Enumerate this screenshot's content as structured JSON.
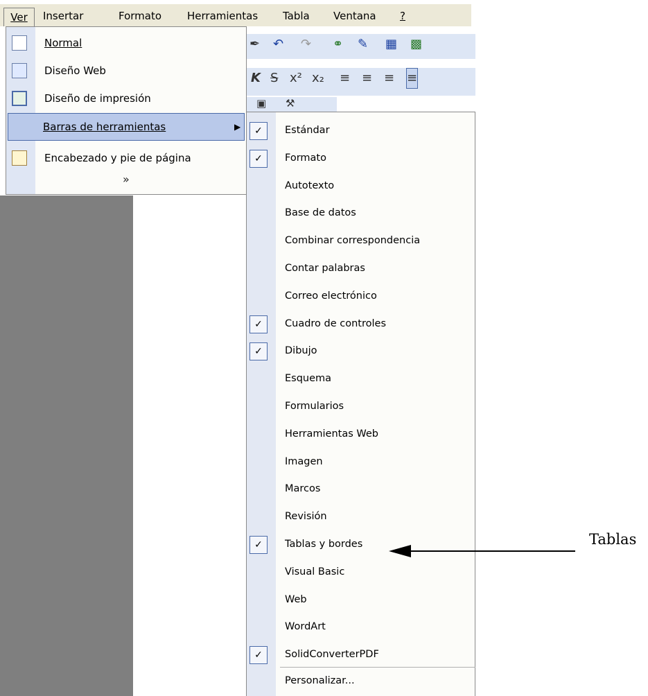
{
  "menubar": {
    "ver": "Ver",
    "insertar": "Insertar",
    "formato": "Formato",
    "herramientas": "Herramientas",
    "tabla": "Tabla",
    "ventana": "Ventana",
    "help": "?"
  },
  "ver_menu": {
    "normal": "Normal",
    "diseno_web": "Diseño Web",
    "diseno_impresion": "Diseño de impresión",
    "barras": "Barras de herramientas",
    "encabezado": "Encabezado y pie de página",
    "expand_glyph": "¥"
  },
  "submenu": {
    "items": [
      {
        "label": "Estándar",
        "checked": true
      },
      {
        "label": "Formato",
        "checked": true
      },
      {
        "label": "Autotexto",
        "checked": false
      },
      {
        "label": "Base de datos",
        "checked": false
      },
      {
        "label": "Combinar correspondencia",
        "checked": false
      },
      {
        "label": "Contar palabras",
        "checked": false
      },
      {
        "label": "Correo electrónico",
        "checked": false
      },
      {
        "label": "Cuadro de controles",
        "checked": true
      },
      {
        "label": "Dibujo",
        "checked": true
      },
      {
        "label": "Esquema",
        "checked": false
      },
      {
        "label": "Formularios",
        "checked": false
      },
      {
        "label": "Herramientas Web",
        "checked": false
      },
      {
        "label": "Imagen",
        "checked": false
      },
      {
        "label": "Marcos",
        "checked": false
      },
      {
        "label": "Revisión",
        "checked": false
      },
      {
        "label": "Tablas y bordes",
        "checked": true
      },
      {
        "label": "Visual Basic",
        "checked": false
      },
      {
        "label": "Web",
        "checked": false
      },
      {
        "label": "WordArt",
        "checked": false
      },
      {
        "label": "SolidConverterPDF",
        "checked": true
      }
    ],
    "personalizar": "Personalizar..."
  },
  "annotation": {
    "label": "Tablas"
  },
  "colors": {
    "menu_bg": "#ece9d8",
    "highlight": "#b9c9ea",
    "doc_gray": "#7f7f7f"
  }
}
